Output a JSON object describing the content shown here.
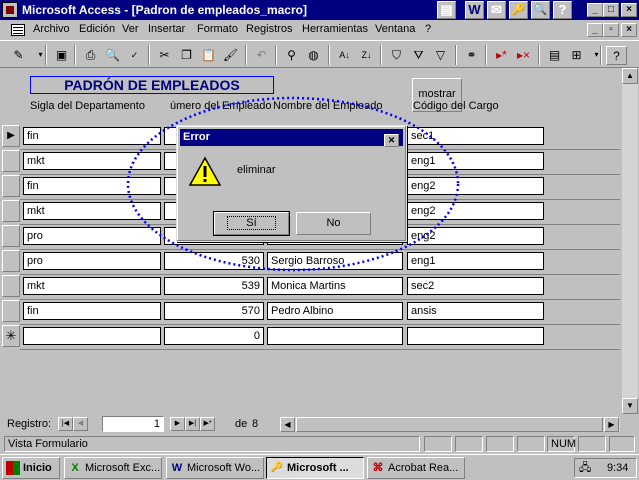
{
  "window": {
    "title": "Microsoft Access - [Padron de empleados_macro]",
    "app_buttons": [
      "W",
      "✉",
      "🔑",
      "🔍",
      "?"
    ]
  },
  "menu": [
    "Archivo",
    "Edición",
    "Ver",
    "Insertar",
    "Formato",
    "Registros",
    "Herramientas",
    "Ventana",
    "?"
  ],
  "form": {
    "title": "PADRÓN DE EMPLEADOS",
    "show_button": "mostrar",
    "headers": {
      "department": "Sigla del Departamento",
      "employee_number": "úmero del Empleado",
      "employee_name": "Nombre del Empleado",
      "role_code": "Código del Cargo"
    },
    "rows": [
      {
        "dept": "fin",
        "num": "",
        "name": "",
        "code": "sec1"
      },
      {
        "dept": "mkt",
        "num": "",
        "name": "",
        "code": "eng1"
      },
      {
        "dept": "fin",
        "num": "",
        "name": "",
        "code": "eng2"
      },
      {
        "dept": "mkt",
        "num": "",
        "name": "",
        "code": "eng2"
      },
      {
        "dept": "pro",
        "num": "",
        "name": "",
        "code": "eng2"
      },
      {
        "dept": "pro",
        "num": "530",
        "name": "Sergio Barroso",
        "code": "eng1"
      },
      {
        "dept": "mkt",
        "num": "539",
        "name": "Monica Martins",
        "code": "sec2"
      },
      {
        "dept": "fin",
        "num": "570",
        "name": "Pedro Albino",
        "code": "ansis"
      },
      {
        "dept": "",
        "num": "0",
        "name": "",
        "code": ""
      }
    ]
  },
  "record_nav": {
    "label": "Registro:",
    "current": "1",
    "of_label": "de",
    "total": "8"
  },
  "status": {
    "text": "Vista Formulario",
    "num_indicator": "NUM"
  },
  "dialog": {
    "title": "Error",
    "message": "eliminar",
    "yes_label": "Sí",
    "no_label": "No"
  },
  "taskbar": {
    "start": "Inicio",
    "tasks": [
      {
        "label": "Microsoft Exc...",
        "icon": "X",
        "color": "#008000"
      },
      {
        "label": "Microsoft Wo...",
        "icon": "W",
        "color": "#000080"
      },
      {
        "label": "Microsoft ...",
        "icon": "🔑",
        "color": "#800000"
      },
      {
        "label": "Acrobat Rea...",
        "icon": "⌘",
        "color": "#c00000"
      }
    ],
    "clock": "9:34"
  },
  "colors": {
    "title_bar": "#000080",
    "form_title": "#000080",
    "annotation": "#0000ff"
  }
}
